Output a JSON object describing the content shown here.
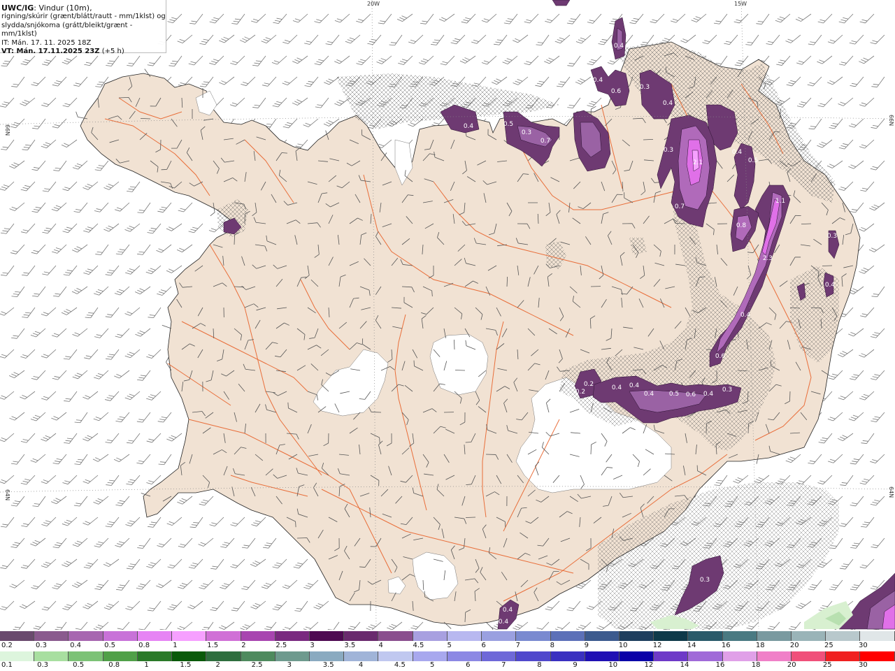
{
  "header": {
    "model": "UWC/IG",
    "line1_rest": ": Vindur (10m),",
    "line2": "rigning/skúrir (grænt/blátt/rautt - mm/1klst) og",
    "line3": "slydda/snjókoma (grátt/bleikt/grænt - mm/1klst)",
    "line4": "IT: Mán. 17. 11. 2025 18Z",
    "line5_bold": "VT: Mán. 17.11.2025 23Z",
    "line5_rest": " (+5 h)"
  },
  "map_labels": {
    "lon_20w": "20W",
    "lon_15w": "15W",
    "lat_66n_left": "66N",
    "lat_66n_right": "66N",
    "lat_64n_left": "64N",
    "lat_64n_right": "64N"
  },
  "precip_values": [
    "0.4",
    "0.4",
    "0.6",
    "0.3",
    "0.4",
    "0.5",
    "0.3",
    "0.7",
    "0.3",
    "0.4",
    "2.1",
    "0.4",
    "0.5",
    "0.7",
    "1.1",
    "0.8",
    "2.3",
    "0.3",
    "0.4",
    "0.4",
    "0.6",
    "0.2",
    "0.2",
    "0.4",
    "0.4",
    "0.4",
    "0.5",
    "0.6",
    "0.4",
    "0.3",
    "0.3",
    "0.4",
    "0.4"
  ],
  "legend": {
    "snow_labels": [
      "0.2",
      "0.3",
      "0.4",
      "0.5",
      "0.8",
      "1",
      "1.5",
      "2",
      "2.5",
      "3",
      "3.5",
      "4",
      "4.5",
      "5",
      "6",
      "7",
      "8",
      "9",
      "10",
      "12",
      "14",
      "16",
      "18",
      "20",
      "25",
      "30"
    ],
    "rain_labels": [
      "0.1",
      "0.3",
      "0.5",
      "0.8",
      "1",
      "1.5",
      "2",
      "2.5",
      "3",
      "3.5",
      "4",
      "4.5",
      "5",
      "6",
      "7",
      "8",
      "9",
      "10",
      "12",
      "14",
      "16",
      "18",
      "20",
      "25",
      "30"
    ],
    "snow_colors": [
      "#6a4a6e",
      "#8a5a8e",
      "#a766b0",
      "#c872d8",
      "#e684f4",
      "#f6a0ff",
      "#d070d6",
      "#a845b0",
      "#7a2a80",
      "#4e0a52",
      "#6a2a6e",
      "#8a4e8e",
      "#a8a0e0",
      "#b8b8f0",
      "#9aa0e0",
      "#7a8ad0",
      "#5c70b8",
      "#3c5a8e",
      "#1e3e5e",
      "#0f3a4a",
      "#2a5a6a",
      "#4a7a82",
      "#7a9aa0",
      "#9ab4b8",
      "#b8c8cc",
      "#e0e6e8"
    ],
    "rain_colors": [
      "#ddf5dd",
      "#a8dfa0",
      "#7cc276",
      "#50a048",
      "#2a7a28",
      "#0a5a0a",
      "#2e6e3e",
      "#4e8a5e",
      "#6e9a8e",
      "#8aaac0",
      "#a0b4d8",
      "#c0c8f0",
      "#a8a8ee",
      "#8c88e4",
      "#6e68d8",
      "#5048cc",
      "#3a30c0",
      "#2010b4",
      "#0a00a8",
      "#6e3ac8",
      "#a06ad8",
      "#e0a0e8",
      "#f080c8",
      "#f0507a",
      "#f02020",
      "#ff0000"
    ]
  },
  "colors": {
    "land": "#f1e2d3",
    "ice": "#ffffff",
    "sea": "#ffffff",
    "roads": "#e8622a",
    "wind": "#666666",
    "snow_light": "#9a62a4",
    "snow_dark": "#6e3a72",
    "snow_bright": "#e070e8"
  }
}
